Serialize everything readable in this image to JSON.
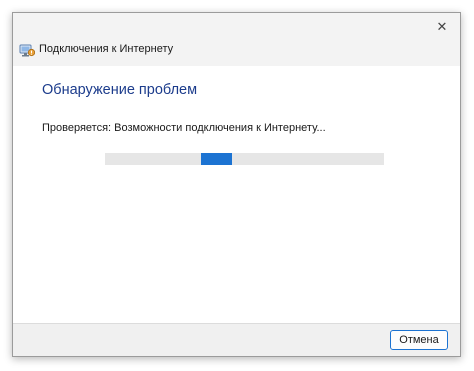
{
  "window": {
    "title": "Подключения к Интернету",
    "close_glyph": "✕"
  },
  "main": {
    "heading": "Обнаружение проблем",
    "status": "Проверяется: Возможности подключения к Интернету..."
  },
  "progress": {
    "mode": "indeterminate"
  },
  "footer": {
    "cancel_label": "Отмена"
  },
  "icons": {
    "app": "network-troubleshooter-icon",
    "close": "close-icon"
  },
  "colors": {
    "accent": "#1c73d2",
    "heading": "#1c3c8c",
    "titlebar_bg": "#f3f3f3",
    "footer_bg": "#f0f0f0",
    "progress_track": "#e6e6e6"
  }
}
